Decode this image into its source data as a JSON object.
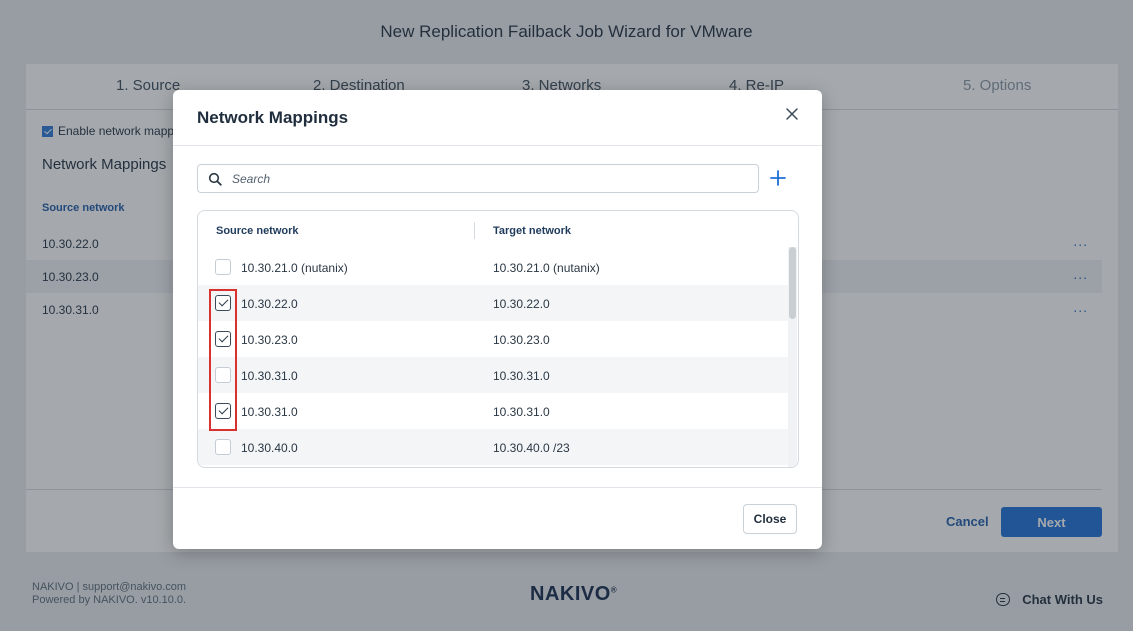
{
  "window": {
    "title": "New Replication Failback Job Wizard for VMware"
  },
  "wizard": {
    "steps": [
      "1. Source",
      "2. Destination",
      "3. Networks",
      "4. Re-IP",
      "5. Options"
    ],
    "enable_label": "Enable network mappi",
    "section_heading": "Network Mappings",
    "column_source": "Source network",
    "rows": [
      "10.30.22.0",
      "10.30.23.0",
      "10.30.31.0"
    ],
    "row_menu": "...",
    "cancel_label": "Cancel",
    "next_label": "Next"
  },
  "footer": {
    "contact": "NAKIVO | support@nakivo.com",
    "powered": "Powered by NAKIVO. v10.10.0.",
    "logo": "NAKIVO",
    "logo_mark": "®",
    "chat_label": "Chat With Us"
  },
  "modal": {
    "title": "Network Mappings",
    "search": {
      "placeholder": "Search"
    },
    "columns": {
      "source": "Source network",
      "target": "Target network"
    },
    "rows": [
      {
        "source": "10.30.21.0 (nutanix)",
        "target": "10.30.21.0 (nutanix)",
        "checked": false
      },
      {
        "source": "10.30.22.0",
        "target": "10.30.22.0",
        "checked": true
      },
      {
        "source": "10.30.23.0",
        "target": "10.30.23.0",
        "checked": true
      },
      {
        "source": "10.30.31.0",
        "target": "10.30.31.0",
        "checked": false
      },
      {
        "source": "10.30.31.0",
        "target": "10.30.31.0",
        "checked": true
      },
      {
        "source": "10.30.40.0",
        "target": "10.30.40.0 /23",
        "checked": false
      }
    ],
    "close_label": "Close"
  },
  "colors": {
    "accent": "#1e6fd8",
    "highlight": "#d9312f",
    "active_step": "#2a77d8"
  },
  "icons": {
    "close": "close-icon",
    "search": "search-icon",
    "add": "plus-icon",
    "chat": "chat-icon"
  }
}
